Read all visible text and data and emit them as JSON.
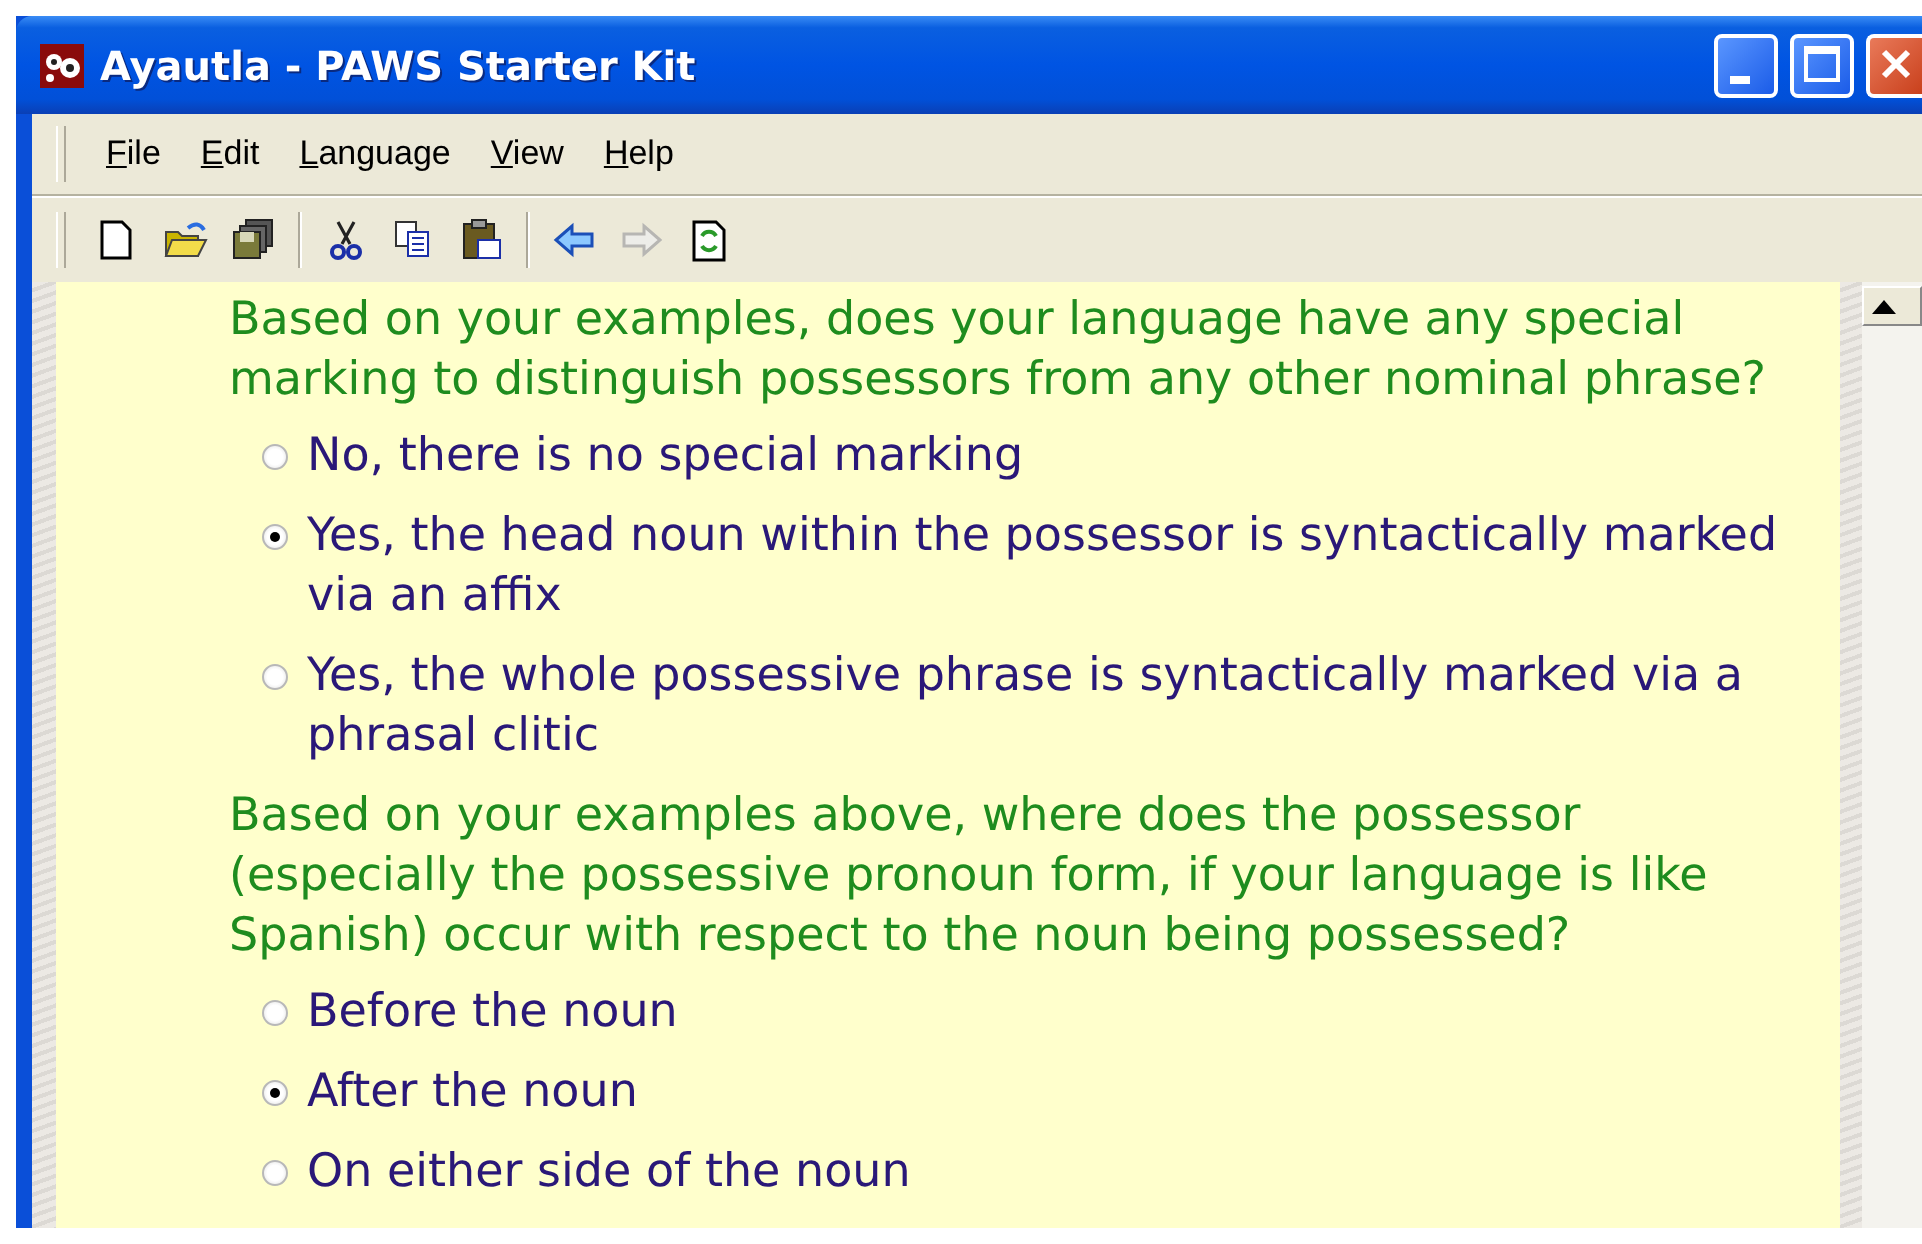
{
  "window": {
    "title": "Ayautla - PAWS Starter Kit"
  },
  "menu": [
    {
      "label": "File"
    },
    {
      "label": "Edit"
    },
    {
      "label": "Language"
    },
    {
      "label": "View"
    },
    {
      "label": "Help"
    }
  ],
  "toolbar": [
    {
      "kind": "new",
      "disabled": false
    },
    {
      "kind": "open",
      "disabled": false
    },
    {
      "kind": "save-all",
      "disabled": false
    },
    {
      "kind": "separator"
    },
    {
      "kind": "cut",
      "disabled": false
    },
    {
      "kind": "copy",
      "disabled": false
    },
    {
      "kind": "paste",
      "disabled": false
    },
    {
      "kind": "separator"
    },
    {
      "kind": "back",
      "disabled": false
    },
    {
      "kind": "forward",
      "disabled": true
    },
    {
      "kind": "refresh",
      "disabled": false
    }
  ],
  "questions": [
    {
      "text": "Based on your examples, does your language have any special marking to distinguish possessors from any other nominal phrase?",
      "options": [
        {
          "label": "No, there is no special marking",
          "selected": false
        },
        {
          "label": "Yes, the head noun within the possessor is syntactically marked via an affix",
          "selected": true
        },
        {
          "label": "Yes, the whole possessive phrase is syntactically marked via a phrasal clitic",
          "selected": false
        }
      ]
    },
    {
      "text": "Based on your examples above, where does the possessor (especially the possessive pronoun form, if your language is like Spanish) occur with respect to the noun being possessed?",
      "options": [
        {
          "label": "Before the noun",
          "selected": false
        },
        {
          "label": "After the noun",
          "selected": true
        },
        {
          "label": "On either side of the noun",
          "selected": false
        }
      ]
    }
  ]
}
